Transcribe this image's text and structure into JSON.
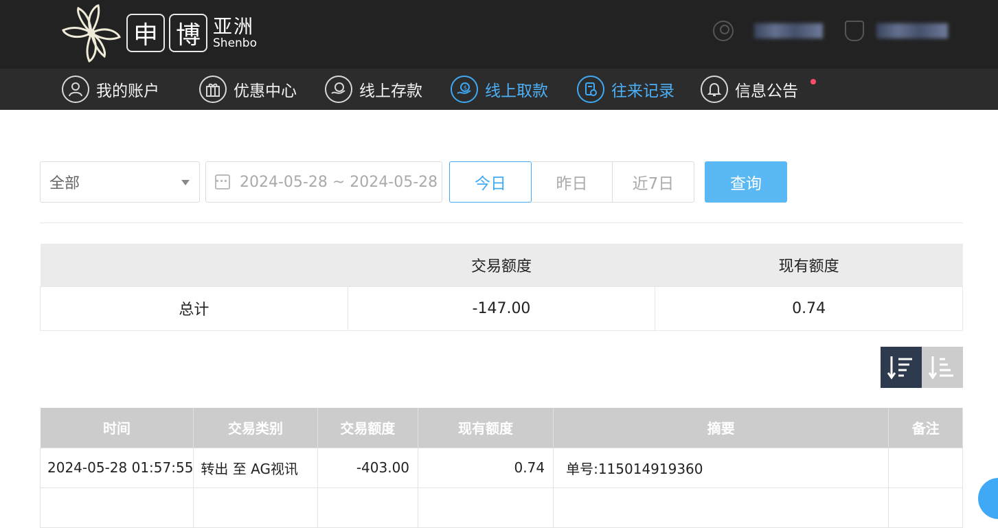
{
  "header": {
    "logo_chars": [
      "申",
      "博"
    ],
    "brand_cn": "亚洲",
    "brand_en": "Shenbo"
  },
  "nav": {
    "items": [
      {
        "label": "我的账户",
        "icon": "user-icon",
        "active": false
      },
      {
        "label": "优惠中心",
        "icon": "gift-icon",
        "active": false
      },
      {
        "label": "线上存款",
        "icon": "deposit-icon",
        "active": false
      },
      {
        "label": "线上取款",
        "icon": "withdraw-icon",
        "active": true
      },
      {
        "label": "往来记录",
        "icon": "records-icon",
        "active": true
      },
      {
        "label": "信息公告",
        "icon": "bell-icon",
        "active": false
      }
    ]
  },
  "filter": {
    "type_selected": "全部",
    "date_range": "2024-05-28 ~ 2024-05-28",
    "quick_ranges": [
      "今日",
      "昨日",
      "近7日"
    ],
    "active_range": "今日",
    "query_label": "查询"
  },
  "summary": {
    "headers": [
      "",
      "交易额度",
      "现有额度"
    ],
    "row": {
      "label": "总计",
      "transaction_amount": "-147.00",
      "current_balance": "0.74"
    }
  },
  "records": {
    "headers": [
      "时间",
      "交易类别",
      "交易额度",
      "现有额度",
      "摘要",
      "备注"
    ],
    "rows": [
      {
        "time": "2024-05-28 01:57:55",
        "type": "转出 至 AG视讯",
        "amount": "-403.00",
        "balance": "0.74",
        "memo": "单号:115014919360",
        "remark": ""
      }
    ]
  },
  "colors": {
    "accent": "#3fa9f5",
    "topbar": "#222222",
    "navbar": "#2c2c2c",
    "sort_active": "#2e3a4d",
    "notification_dot": "#ff4d6a"
  }
}
